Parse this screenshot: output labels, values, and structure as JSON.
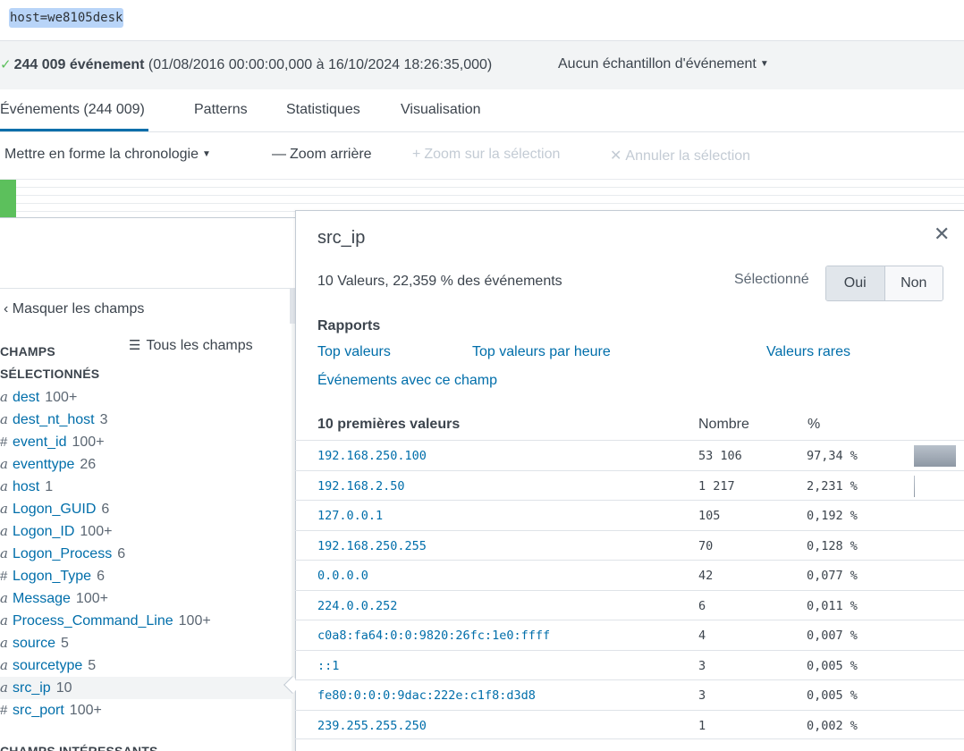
{
  "search": {
    "query": "host=we8105desk"
  },
  "status": {
    "check_icon": "checkmark-icon",
    "count": "244 009 événement",
    "range": "(01/08/2016 00:00:00,000 à 16/10/2024 18:26:35,000)",
    "sampling": "Aucun échantillon d'événement"
  },
  "tabs": [
    {
      "label": "Événements (244 009)",
      "active": true
    },
    {
      "label": "Patterns"
    },
    {
      "label": "Statistiques"
    },
    {
      "label": "Visualisation"
    }
  ],
  "timeline_toolbar": {
    "format": "Mettre en forme la chronologie",
    "zoom_out": "Zoom arrière",
    "zoom_in": "Zoom sur la sélection",
    "cancel": "Annuler la sélection"
  },
  "sidebar": {
    "hide_fields": "Masquer les champs",
    "all_fields": "Tous les champs",
    "selected_title_1": "CHAMPS",
    "selected_title_2": "SÉLECTIONNÉS",
    "interesting_title": "CHAMPS INTÉRESSANTS",
    "fields": [
      {
        "type": "a",
        "name": "dest",
        "count": "100+"
      },
      {
        "type": "a",
        "name": "dest_nt_host",
        "count": "3"
      },
      {
        "type": "#",
        "name": "event_id",
        "count": "100+"
      },
      {
        "type": "a",
        "name": "eventtype",
        "count": "26"
      },
      {
        "type": "a",
        "name": "host",
        "count": "1"
      },
      {
        "type": "a",
        "name": "Logon_GUID",
        "count": "6"
      },
      {
        "type": "a",
        "name": "Logon_ID",
        "count": "100+"
      },
      {
        "type": "a",
        "name": "Logon_Process",
        "count": "6"
      },
      {
        "type": "#",
        "name": "Logon_Type",
        "count": "6"
      },
      {
        "type": "a",
        "name": "Message",
        "count": "100+"
      },
      {
        "type": "a",
        "name": "Process_Command_Line",
        "count": "100+"
      },
      {
        "type": "a",
        "name": "source",
        "count": "5"
      },
      {
        "type": "a",
        "name": "sourcetype",
        "count": "5"
      },
      {
        "type": "a",
        "name": "src_ip",
        "count": "10",
        "selected": true
      },
      {
        "type": "#",
        "name": "src_port",
        "count": "100+"
      }
    ]
  },
  "popover": {
    "title": "src_ip",
    "summary": "10 Valeurs, 22,359 % des événements",
    "selected_label": "Sélectionné",
    "yes": "Oui",
    "no": "Non",
    "selected_value": "Oui",
    "reports_title": "Rapports",
    "reports": {
      "top_values": "Top valeurs",
      "top_values_hour": "Top valeurs par heure",
      "rare_values": "Valeurs rares",
      "events_with_field": "Événements avec ce champ"
    },
    "top_title": "10 premières valeurs",
    "col_count": "Nombre",
    "col_pct": "%",
    "rows": [
      {
        "value": "192.168.250.100",
        "count": "53 106",
        "pct": "97,34 %",
        "pct_num": 97.34
      },
      {
        "value": "192.168.2.50",
        "count": "1 217",
        "pct": "2,231 %",
        "pct_num": 2.231
      },
      {
        "value": "127.0.0.1",
        "count": "105",
        "pct": "0,192 %",
        "pct_num": 0.192
      },
      {
        "value": "192.168.250.255",
        "count": "70",
        "pct": "0,128 %",
        "pct_num": 0.128
      },
      {
        "value": "0.0.0.0",
        "count": "42",
        "pct": "0,077 %",
        "pct_num": 0.077
      },
      {
        "value": "224.0.0.252",
        "count": "6",
        "pct": "0,011 %",
        "pct_num": 0.011
      },
      {
        "value": "c0a8:fa64:0:0:9820:26fc:1e0:ffff",
        "count": "4",
        "pct": "0,007 %",
        "pct_num": 0.007
      },
      {
        "value": "::1",
        "count": "3",
        "pct": "0,005 %",
        "pct_num": 0.005
      },
      {
        "value": "fe80:0:0:0:9dac:222e:c1f8:d3d8",
        "count": "3",
        "pct": "0,005 %",
        "pct_num": 0.005
      },
      {
        "value": "239.255.255.250",
        "count": "1",
        "pct": "0,002 %",
        "pct_num": 0.002
      }
    ]
  },
  "colors": {
    "link": "#006eaa",
    "accent": "#006eaa",
    "success": "#5cc05c",
    "highlight": "#b8d4f8"
  }
}
